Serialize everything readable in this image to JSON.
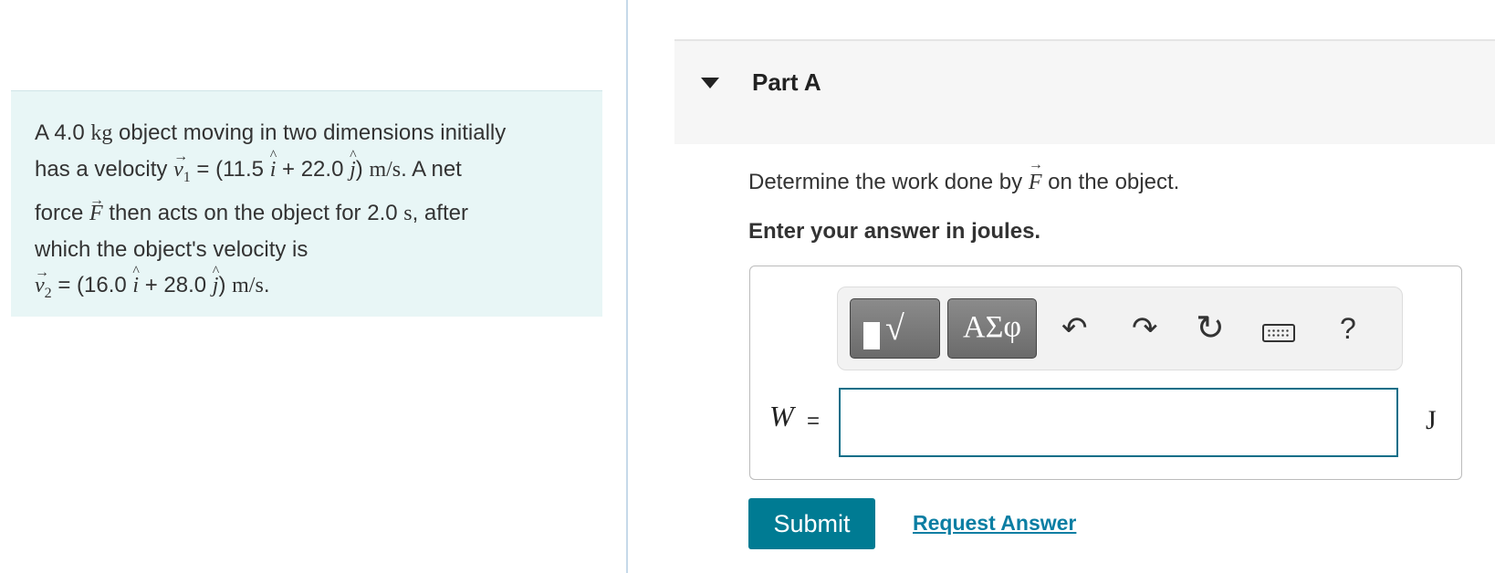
{
  "problem": {
    "line1_a": "A 4.0 ",
    "line1_unit": "kg",
    "line1_b": " object moving in two dimensions initially",
    "line2_a": "has a velocity ",
    "v": "v",
    "sub1": "1",
    "line2_b": " = (11.5 ",
    "i": "i",
    "line2_c": " + 22.0 ",
    "j": "j",
    "unit_ms": "m/s",
    "line2_d": ". A net",
    "line3_a": "force ",
    "F": "F",
    "line3_b": " then acts on the object for 2.0 ",
    "s": "s",
    "line3_c": ", after",
    "line4": "which the object's velocity is",
    "sub2": "2",
    "line5_b": " = (16.0 ",
    "line5_c": " + 28.0 ",
    "line5_d": "."
  },
  "part": {
    "title": "Part A"
  },
  "question": {
    "text_a": "Determine the work done by ",
    "F": "F",
    "text_b": " on the object.",
    "instruction": "Enter your answer in joules."
  },
  "toolbar": {
    "greek_label": "ΑΣφ",
    "radical_glyph": "√",
    "help_label": "?",
    "icons": [
      "template-icon",
      "greek-letters-icon",
      "undo-icon",
      "redo-icon",
      "reset-icon",
      "keyboard-icon",
      "help-icon"
    ]
  },
  "answer": {
    "variable": "W",
    "equals": "=",
    "value": "",
    "unit": "J"
  },
  "actions": {
    "submit_label": "Submit",
    "request_label": "Request Answer"
  },
  "colors": {
    "problem_bg": "#e8f6f6",
    "accent": "#007b93",
    "link": "#0b7ea3",
    "input_border": "#0a6e88"
  }
}
